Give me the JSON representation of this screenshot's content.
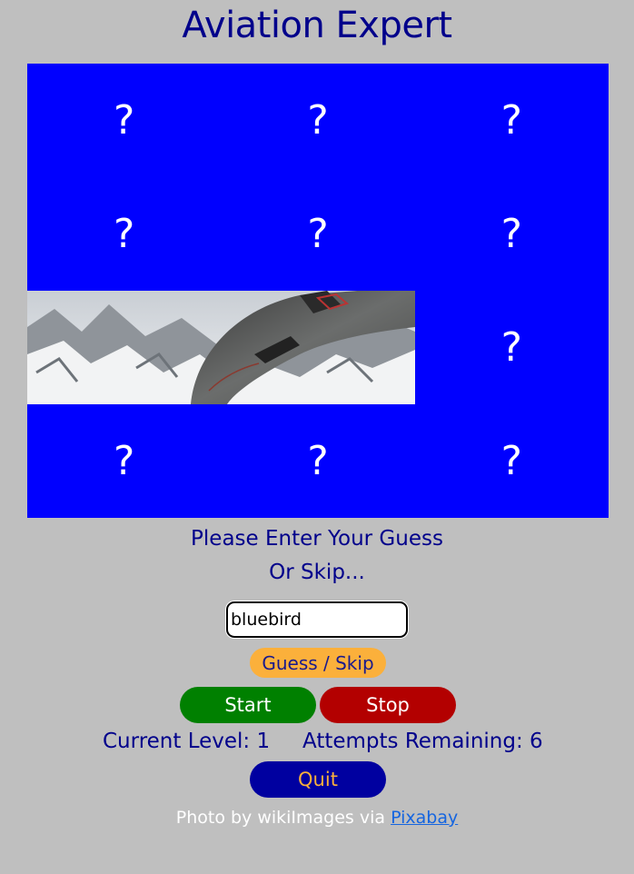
{
  "title": "Aviation Expert",
  "tiles": [
    "?",
    "?",
    "?",
    "?",
    "?",
    "?",
    "?",
    "?",
    "?",
    "?",
    "?",
    "?"
  ],
  "revealed_tiles": [
    6,
    7
  ],
  "prompt_line1": "Please Enter Your Guess",
  "prompt_line2": "Or Skip...",
  "guess_input": {
    "value": "bluebird"
  },
  "buttons": {
    "guess_skip": "Guess / Skip",
    "start": "Start",
    "stop": "Stop",
    "quit": "Quit"
  },
  "status": {
    "level": "Current Level: 1",
    "attempts": "Attempts Remaining: 6"
  },
  "credit": {
    "text": "Photo by wikiImages via ",
    "link": "Pixabay"
  },
  "colors": {
    "background": "#bfbfbf",
    "title": "#00008b",
    "tile": "#0000ff",
    "guess_button": "#fbb03b",
    "start_button": "#008000",
    "stop_button": "#b30000",
    "quit_button": "#0000a0"
  }
}
